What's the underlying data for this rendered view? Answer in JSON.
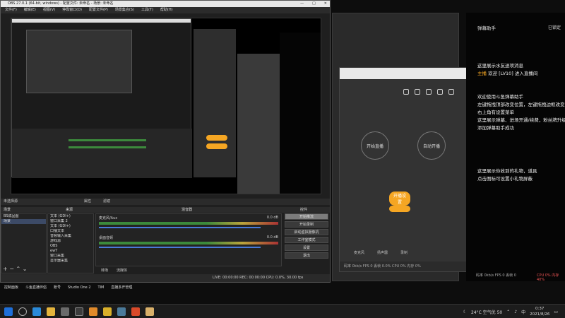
{
  "obs": {
    "title": "OBS 27.0.1 (64-bit, windows) - 配置文件: 未命名 - 场景: 未命名",
    "menu": [
      "文件(F)",
      "编辑(E)",
      "视图(V)",
      "停靠窗口(D)",
      "配置文件(P)",
      "场景集合(S)",
      "工具(T)",
      "帮助(H)"
    ],
    "no_source": "未选择源",
    "props_btn": "属性",
    "filters_btn": "滤镜",
    "scenes_header": "场景",
    "sources_header": "来源",
    "mixer_header": "混音器",
    "transitions_header": "转场",
    "controls_header": "控件",
    "scenes": [
      "BS成品图",
      "场景"
    ],
    "sources": [
      "文本 (GDI+)",
      "窗口采集 2",
      "文本 (GDI+)",
      "口播文本",
      "音频输入采集",
      "游戏源",
      "OBS",
      "ewT",
      "窗口采集",
      "显示器采集"
    ],
    "mixer": [
      {
        "name": "麦克风/Aux",
        "db": "0.0 dB",
        "level": 0.7
      },
      {
        "name": "桌面音频",
        "db": "0.0 dB",
        "level": 0.8
      }
    ],
    "controls": [
      "开始推流",
      "开始录制",
      "启动虚拟摄像机",
      "工作室模式",
      "设置",
      "退出"
    ],
    "dock_tabs": [
      "转场",
      "流媒体"
    ],
    "status": "LIVE: 00:00:00  REC: 00:00:00  CPU: 0.0%, 30.00 fps"
  },
  "strip": [
    "控制面板",
    "斗鱼直播伴侣",
    "账号",
    "Studio One 2",
    "TIM",
    "直播多开管理"
  ],
  "live_app": {
    "btn_start": "开始直播",
    "btn_auto": "自动开播",
    "label_kaibo": "开播设置",
    "label_mic": "麦克风",
    "label_speaker": "扬声器",
    "label_record": "录制",
    "stat_bar": "码率 0kb/s  FPS 0  丢帧 0.0%  CPU 0%  内存 0%"
  },
  "danmu": {
    "title": "弹幕助手",
    "lock": "已锁定",
    "lines": [
      "这里展示水友送项消息",
      "欢迎 [LV10] 进入直播间",
      "欢迎使用斗鱼弹幕助手",
      "左键拖拽顶部改变位置，左键拖拽边框改变大小",
      "右上角有设置菜单",
      "这里展示弹幕、进场开通/续费，粉丝牌升级等",
      "添加弹幕助手成功",
      "这里展示你收到的礼物，道具",
      "点击图标可设置小礼物屏蔽"
    ],
    "highlight_user": "主播",
    "stats": "码率 0kb/s  FPS 0  丢帧 0",
    "right_stat": "CPU 0%  内存 40%"
  },
  "taskbar": {
    "weather": "24°C 空气优 50",
    "time": "0:37",
    "date": "2021/8/26",
    "lang": "中"
  }
}
